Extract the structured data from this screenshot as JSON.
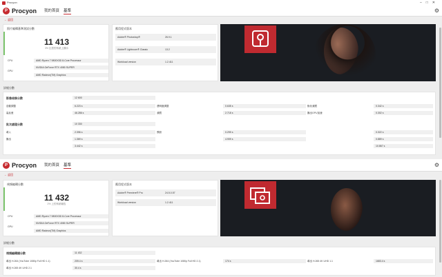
{
  "w1": {
    "titlebar": "Procyon",
    "brand": "Procyon",
    "nav": [
      "我的首頁",
      "基準"
    ],
    "back": "返回",
    "left": {
      "title": "照片編輯基準測試分數",
      "score": "11 413",
      "sub": "3% 比您的系統上顯示",
      "hw": [
        {
          "label": "CPU",
          "value": "AMD Ryzen 7 9800X3D 8-Core Processor"
        },
        {
          "label": "GPU",
          "value": "NVIDIA GeForce RTX 4080 SUPER"
        },
        {
          "label": "",
          "value": "AMD Radeon(TM) Graphics"
        }
      ]
    },
    "mid": {
      "title": "應用程式版本",
      "rows": [
        {
          "label": "Adobe® Photoshop®",
          "value": "26.9.1"
        },
        {
          "label": "Adobe® Lightroom® Classic",
          "value": "13.2"
        },
        {
          "label": "Workload version",
          "value": "1.2.411"
        }
      ]
    },
    "details_title": "詳細分數",
    "g1": {
      "label": "影像修飾分數",
      "value": "12 600",
      "rows": [
        [
          "自動調整",
          "6.223 s",
          "透明度調整",
          "0.635 s",
          "銳化濾鏡",
          "0.342 s"
        ],
        [
          "高反差",
          "46.286 s",
          "濾鏡",
          "2.718 s",
          "匯出GPU加速",
          "0.302 s"
        ]
      ]
    },
    "g2": {
      "label": "批次處理分數",
      "value": "10 330",
      "rows": [
        [
          "導入",
          "2.396 s",
          "預設",
          "0.299 s",
          "",
          "0.322 s"
        ],
        [
          "匯出",
          "1.369 s",
          "",
          "4.909 s",
          "",
          "0.889 s"
        ],
        [
          "",
          "3.442 s",
          "",
          "",
          "",
          "10.867 s"
        ]
      ]
    }
  },
  "w2": {
    "brand": "Procyon",
    "nav": [
      "我的首頁",
      "基準"
    ],
    "back": "返回",
    "left": {
      "title": "視頻編輯分數",
      "score": "11 432",
      "sub": "2% 上的系統報告",
      "hw": [
        {
          "label": "CPU",
          "value": "AMD Ryzen 7 9800X3D 8-Core Processor"
        },
        {
          "label": "GPU",
          "value": "NVIDIA GeForce RTX 4080 SUPER"
        },
        {
          "label": "",
          "value": "AMD Radeon(TM) Graphics"
        }
      ]
    },
    "mid": {
      "title": "應用程式版本",
      "rows": [
        {
          "label": "Adobe® Premiere® Pro",
          "value": "24.5.0.57"
        },
        {
          "label": "Workload version",
          "value": "1.2.411"
        }
      ]
    },
    "details_title": "詳細分數",
    "g1": {
      "label": "視頻編輯總分數",
      "value": "11 432",
      "rows": [
        [
          "導出 H.264 (YouTube 1080p Full HD 1.1)",
          "209.4 s",
          "導出 H.264 (YouTube 1080p Full HD 2.1)",
          "174 s",
          "導出 H.265 4K UHD 1.1",
          "1683.4 s"
        ],
        [
          "導出 H.265 4K UHD 2.1",
          "30.4 s",
          "",
          "",
          "",
          ""
        ]
      ]
    }
  },
  "colors": {
    "accent": "#c62a2f",
    "green": "#7ac36a"
  }
}
